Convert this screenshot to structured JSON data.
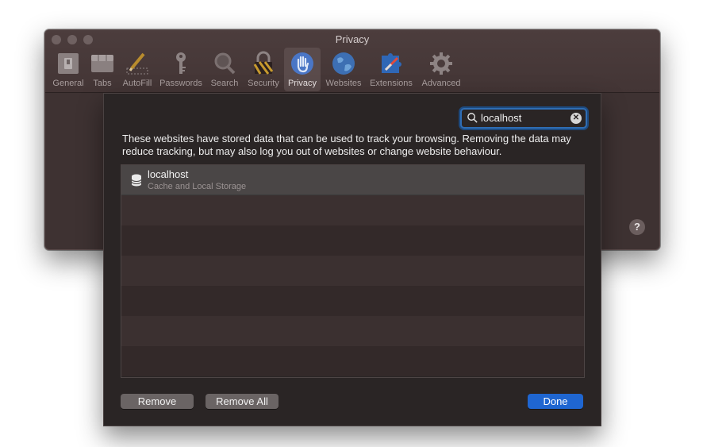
{
  "window": {
    "title": "Privacy",
    "toolbar": [
      {
        "label": "General",
        "icon": "general-switch-icon"
      },
      {
        "label": "Tabs",
        "icon": "tabs-icon"
      },
      {
        "label": "AutoFill",
        "icon": "pencil-icon"
      },
      {
        "label": "Passwords",
        "icon": "key-icon"
      },
      {
        "label": "Search",
        "icon": "magnifier-icon"
      },
      {
        "label": "Security",
        "icon": "lock-icon"
      },
      {
        "label": "Privacy",
        "icon": "hand-icon",
        "active": true
      },
      {
        "label": "Websites",
        "icon": "globe-icon"
      },
      {
        "label": "Extensions",
        "icon": "puzzle-compass-icon"
      },
      {
        "label": "Advanced",
        "icon": "gear-icon"
      }
    ],
    "help_label": "?"
  },
  "sheet": {
    "search": {
      "value": "localhost",
      "clear_label": "✕"
    },
    "description": "These websites have stored data that can be used to track your browsing. Removing the data may reduce tracking, but may also log you out of websites or change website behaviour.",
    "sites": [
      {
        "name": "localhost",
        "detail": "Cache and Local Storage"
      }
    ],
    "buttons": {
      "remove": "Remove",
      "remove_all": "Remove All",
      "done": "Done"
    }
  },
  "colors": {
    "accent": "#1f66d1",
    "focus_ring": "#2f6db4",
    "window_bg": "#3e3232",
    "sheet_bg": "#2a2525"
  }
}
